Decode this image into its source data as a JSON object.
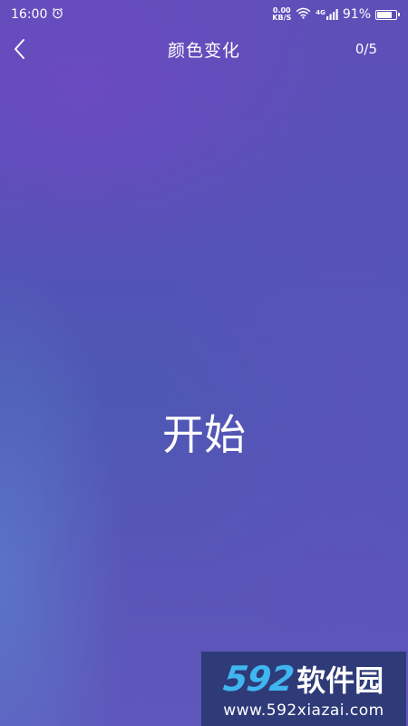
{
  "status_bar": {
    "time": "16:00",
    "net_speed_value": "0.00",
    "net_speed_unit": "KB/S",
    "network_type": "4G",
    "battery_percent": "91%",
    "battery_level": 0.91
  },
  "header": {
    "title": "颜色变化",
    "progress": "0/5"
  },
  "main": {
    "start_label": "开始"
  },
  "watermark": {
    "brand_number": "592",
    "brand_text": "软件园",
    "url": "www.592xiazai.com"
  },
  "colors": {
    "background_primary": "#5552b6",
    "text": "#ffffff",
    "watermark_bg": "#2f3b78",
    "watermark_accent": "#3fb6f0"
  },
  "icons": [
    "alarm-icon",
    "wifi-icon",
    "signal-icon",
    "battery-icon",
    "back-chevron-icon"
  ]
}
